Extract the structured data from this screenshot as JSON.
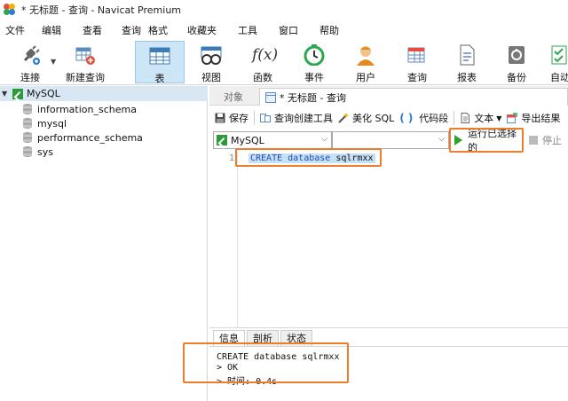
{
  "window": {
    "title": "* 无标题 - 查询 - Navicat Premium"
  },
  "menu": [
    "文件",
    "编辑",
    "查看",
    "查询",
    "格式",
    "收藏夹",
    "工具",
    "窗口",
    "帮助"
  ],
  "toolbar": {
    "buttons": [
      {
        "label": "连接",
        "icon": "plug-icon"
      },
      {
        "label": "新建查询",
        "icon": "new-query-icon"
      },
      {
        "label": "表",
        "icon": "table-icon",
        "active": true
      },
      {
        "label": "视图",
        "icon": "view-icon"
      },
      {
        "label": "函数",
        "icon": "function-icon",
        "glyph": "f(x)"
      },
      {
        "label": "事件",
        "icon": "clock-icon"
      },
      {
        "label": "用户",
        "icon": "user-icon"
      },
      {
        "label": "查询",
        "icon": "query-icon"
      },
      {
        "label": "报表",
        "icon": "report-icon"
      },
      {
        "label": "备份",
        "icon": "backup-icon"
      },
      {
        "label": "自动",
        "icon": "automation-icon"
      }
    ]
  },
  "tree": {
    "root": "MySQL",
    "items": [
      "information_schema",
      "mysql",
      "performance_schema",
      "sys"
    ]
  },
  "tabs": {
    "objects": "对象",
    "query": "* 无标题 - 查询"
  },
  "query_toolbar": {
    "save": "保存",
    "builder": "查询创建工具",
    "beautify": "美化 SQL",
    "snippet": "代码段",
    "text": "文本",
    "export": "导出结果"
  },
  "connection": {
    "selected": "MySQL",
    "database": ""
  },
  "run": {
    "label": "运行已选择的",
    "stop": "停止"
  },
  "editor": {
    "line_number": "1",
    "sql": "CREATE database sqlrmxx",
    "sql_keyword": "CREATE database",
    "sql_name": "sqlrmxx"
  },
  "result_tabs": [
    "信息",
    "剖析",
    "状态"
  ],
  "output": {
    "lines": [
      "CREATE database sqlrmxx",
      "> OK",
      "> 时间: 0.4s"
    ]
  },
  "colors": {
    "highlight": "#f07b2a",
    "accent": "#cde6f7",
    "run_green": "#2aa52a"
  }
}
